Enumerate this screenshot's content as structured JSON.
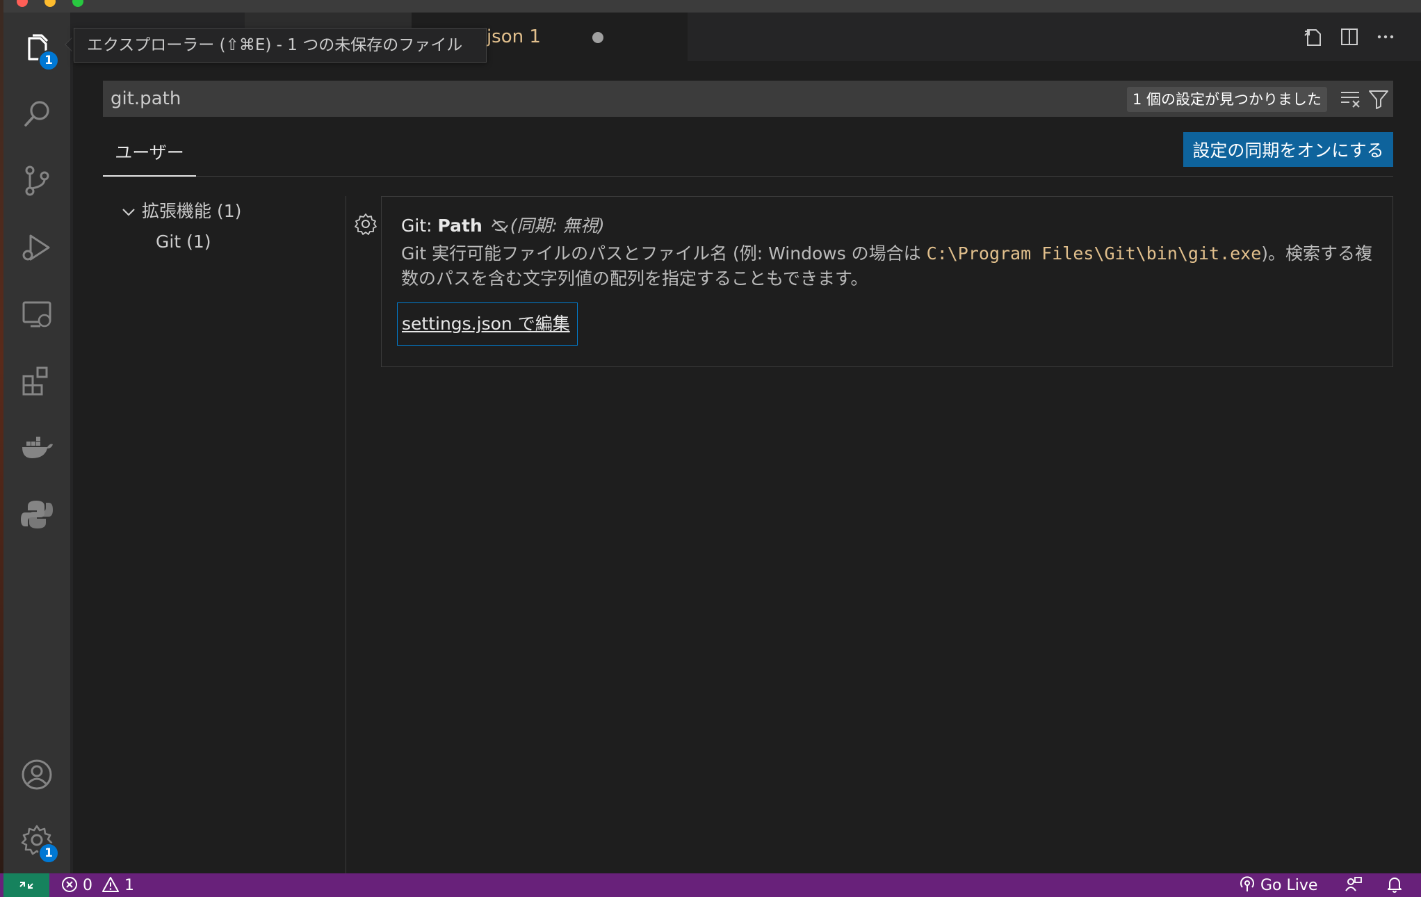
{
  "window": {
    "tab_title": "settings.json 1"
  },
  "tooltip": {
    "text": "エクスプローラー (⇧⌘E) - 1 つの未保存のファイル"
  },
  "activity_bar": {
    "explorer_badge": "1",
    "manage_badge": "1",
    "items": [
      "explorer-icon",
      "search-icon",
      "source-control-icon",
      "run-debug-icon",
      "remote-explorer-icon",
      "extensions-icon",
      "docker-icon",
      "python-icon",
      "account-icon",
      "manage-gear-icon"
    ]
  },
  "search": {
    "value": "git.path",
    "result_count": "1 個の設定が見つかりました"
  },
  "scope_tabs": {
    "user_label": "ユーザー"
  },
  "sync_button": {
    "label": "設定の同期をオンにする"
  },
  "toc": {
    "group_label": "拡張機能 (1)",
    "item_label": "Git (1)"
  },
  "setting": {
    "category": "Git: ",
    "name": "Path",
    "sync_note": "(同期: 無視)",
    "description_pre": "Git 実行可能ファイルのパスとファイル名 (例: Windows の場合は ",
    "description_code": "C:\\Program Files\\Git\\bin\\git.exe",
    "description_post": ")。検索する複数のパスを含む文字列値の配列を指定することもできます。",
    "edit_link": "settings.json で編集"
  },
  "status_bar": {
    "errors": "0",
    "warnings": "1",
    "go_live": "Go Live"
  },
  "colors": {
    "status_bar": "#68217a",
    "remote": "#16825d",
    "accent": "#0e639c",
    "badge": "#0078d4",
    "modified_tab": "#e2c08d"
  }
}
